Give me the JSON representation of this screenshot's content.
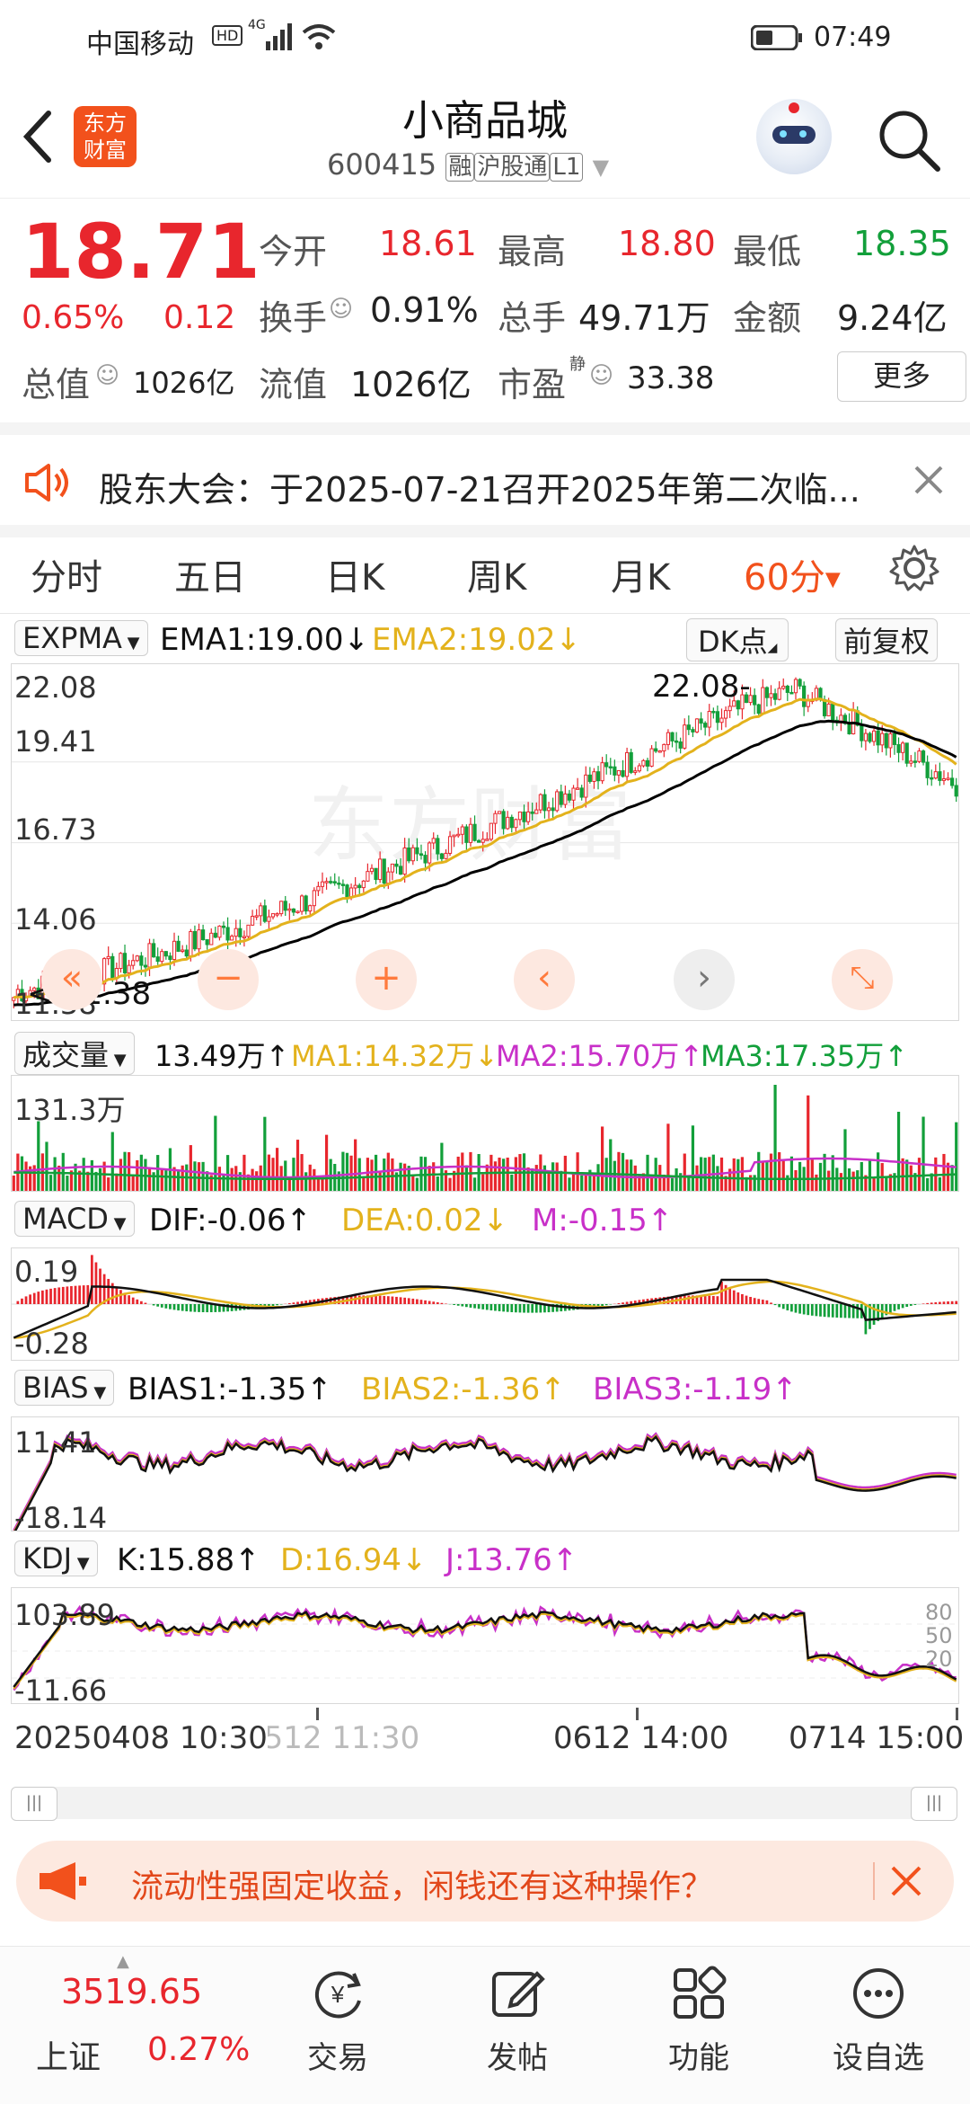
{
  "status": {
    "carrier": "中国移动",
    "net": "4G",
    "time": "07:49"
  },
  "header": {
    "title": "小商品城",
    "code": "600415",
    "tags": [
      "融",
      "沪股通",
      "L1"
    ],
    "logo": "东方财富",
    "back_icon": "back-arrow-icon",
    "search_icon": "search-icon"
  },
  "quote": {
    "price": "18.71",
    "pct": "0.65%",
    "chg": "0.12",
    "open_label": "今开",
    "open": "18.61",
    "high_label": "最高",
    "high": "18.80",
    "low_label": "最低",
    "low": "18.35",
    "turnover_label": "换手",
    "turnover": "0.91%",
    "volume_label": "总手",
    "volume": "49.71万",
    "amount_label": "金额",
    "amount": "9.24亿",
    "mktcap_label": "总值",
    "mktcap": "1026亿",
    "float_label": "流值",
    "float": "1026亿",
    "pe_label": "市盈",
    "pe_sup": "静",
    "pe": "33.38",
    "more": "更多"
  },
  "notice": {
    "text": "股东大会：于2025-07-21召开2025年第二次临..."
  },
  "tabs": [
    "分时",
    "五日",
    "日K",
    "周K",
    "月K",
    "60分"
  ],
  "active_tab": "60分",
  "main_chart": {
    "indicator": "EXPMA",
    "ema1": "EMA1:19.00↓",
    "ema2": "EMA2:19.02↓",
    "dk": "DK点",
    "fq": "前复权",
    "y_labels": [
      "22.08",
      "19.41",
      "16.73",
      "14.06",
      "11.38"
    ],
    "max_note": "22.08-",
    "min_note": "<-11.38",
    "colors": {
      "up": "#e8262d",
      "down": "#129f3a",
      "ema1": "#000000",
      "ema2": "#e3b21c"
    }
  },
  "volume_chart": {
    "name": "成交量",
    "cur": "13.49万↑",
    "ma1": "MA1:14.32万↓",
    "ma2": "MA2:15.70万↑",
    "ma3": "MA3:17.35万↑",
    "ymax": "131.3万"
  },
  "macd": {
    "name": "MACD",
    "dif": "DIF:-0.06↑",
    "dea": "DEA:0.02↓",
    "m": "M:-0.15↑",
    "ytop": "0.19",
    "ybot": "-0.28"
  },
  "bias": {
    "name": "BIAS",
    "b1": "BIAS1:-1.35↑",
    "b2": "BIAS2:-1.36↑",
    "b3": "BIAS3:-1.19↑",
    "ytop": "11.41",
    "ybot": "-18.14"
  },
  "kdj": {
    "name": "KDJ",
    "k": "K:15.88↑",
    "d": "D:16.94↓",
    "j": "J:13.76↑",
    "ytop": "103.89",
    "ybot": "-11.66",
    "ref": [
      "80",
      "50",
      "20"
    ]
  },
  "time_axis": {
    "t1": "20250408 10:30",
    "t1b": "0512 11:30",
    "t2": "0612 14:00",
    "t3": "0714 15:00"
  },
  "ad": {
    "text": "流动性强固定收益，闲钱还有这种操作？"
  },
  "bottom": {
    "index_value": "3519.65",
    "index_name": "上证",
    "index_pct": "0.27%",
    "nav": [
      {
        "label": "交易",
        "icon": "yen-cycle-icon"
      },
      {
        "label": "发帖",
        "icon": "edit-icon"
      },
      {
        "label": "功能",
        "icon": "grid-icon"
      },
      {
        "label": "设自选",
        "icon": "more-dots-icon"
      }
    ]
  }
}
